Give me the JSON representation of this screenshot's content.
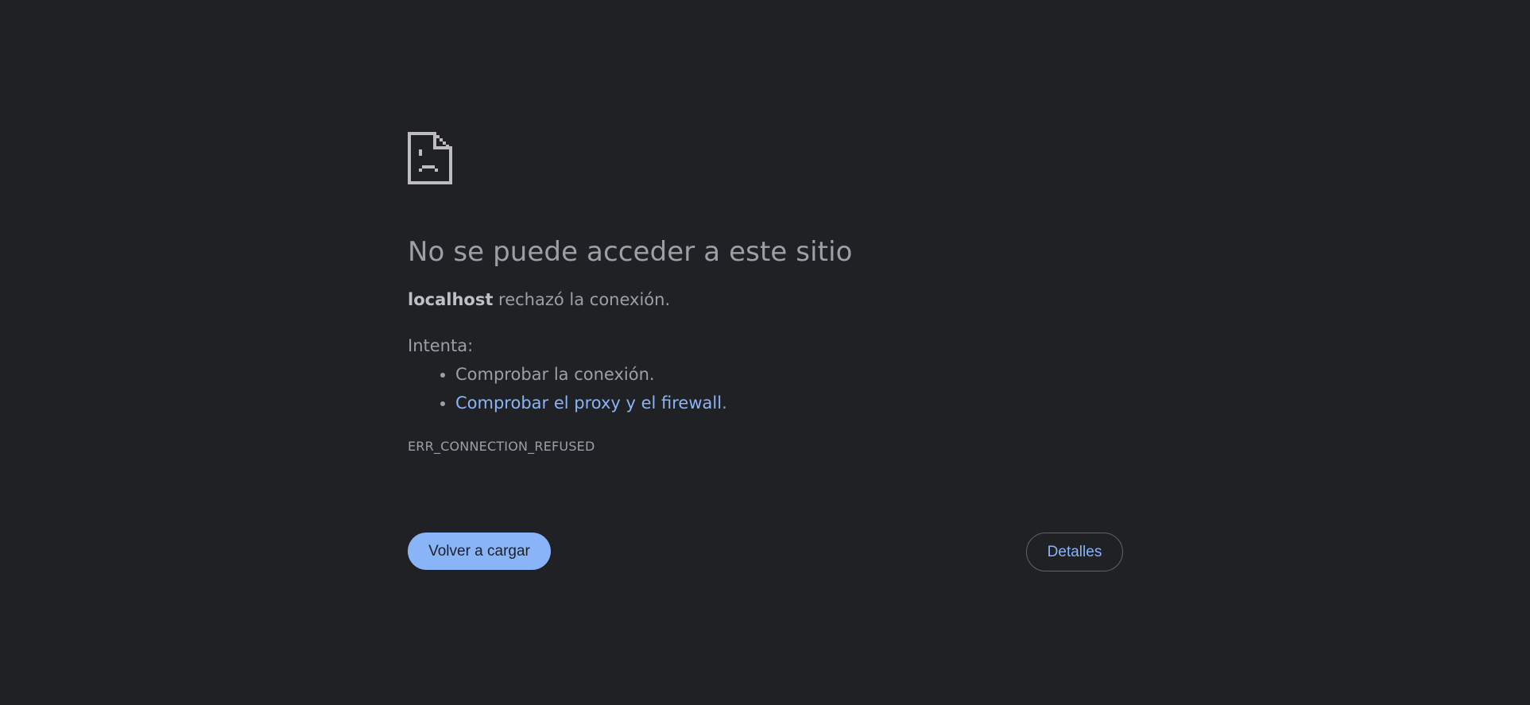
{
  "error": {
    "icon": "sad-document-icon",
    "heading": "No se puede acceder a este sitio",
    "host": "localhost",
    "summary_suffix": " rechazó la conexión.",
    "suggestions_label": "Intenta:",
    "suggestions": [
      {
        "text": "Comprobar la conexión."
      },
      {
        "link_text": "Comprobar el proxy y el firewall",
        "suffix": "."
      }
    ],
    "code": "ERR_CONNECTION_REFUSED"
  },
  "buttons": {
    "reload_label": "Volver a cargar",
    "details_label": "Detalles"
  },
  "colors": {
    "background": "#202124",
    "text": "#9aa0a6",
    "link": "#8ab4f8",
    "primary_button": "#8ab4f8",
    "icon": "#bdbdbd"
  }
}
